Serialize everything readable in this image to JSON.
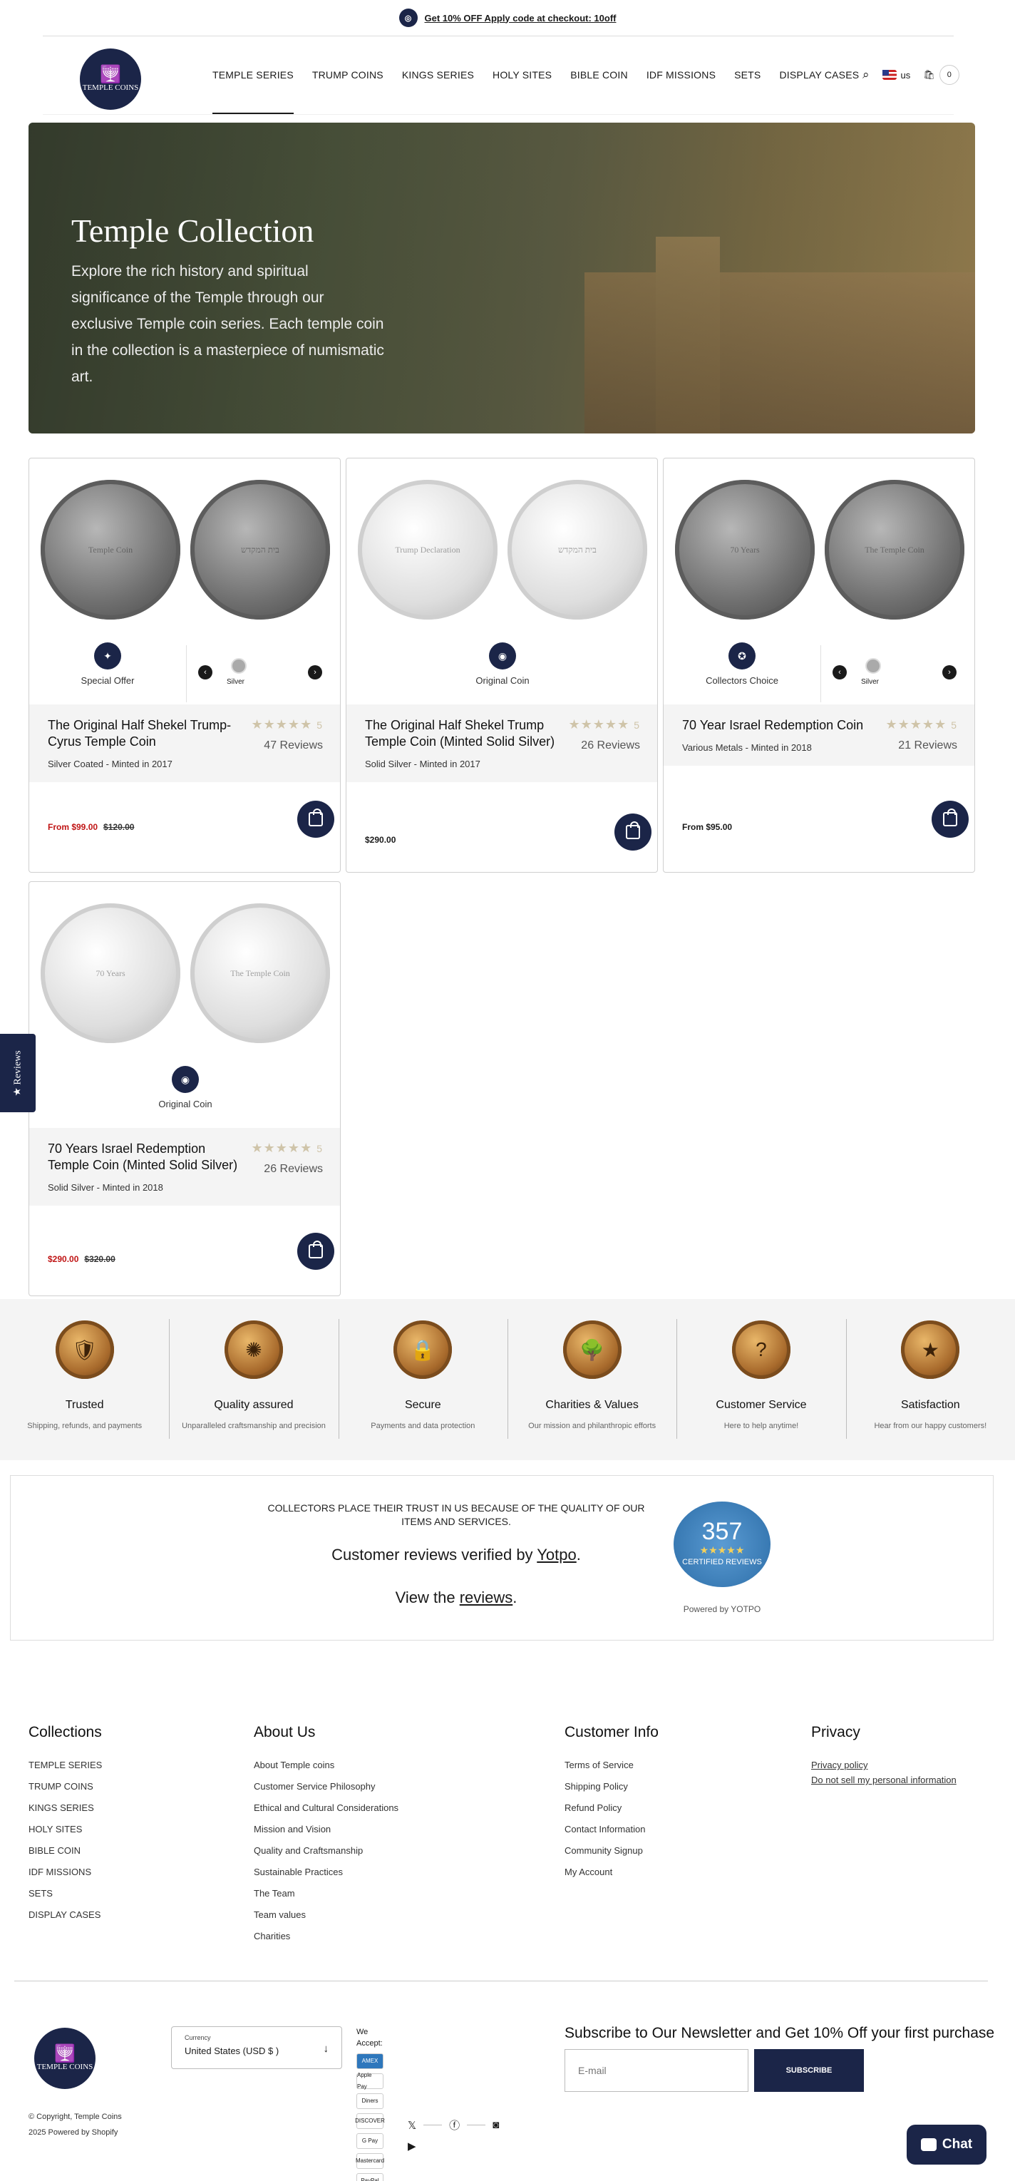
{
  "announcement": {
    "text": "Get 10% OFF Apply code at checkout: 10off",
    "icon": "coin-icon"
  },
  "brand": {
    "logo_text": "TEMPLE COINS"
  },
  "nav": [
    "TEMPLE SERIES",
    "TRUMP COINS",
    "KINGS SERIES",
    "HOLY SITES",
    "BIBLE COIN",
    "IDF MISSIONS",
    "SETS",
    "DISPLAY CASES"
  ],
  "header": {
    "locale": "us",
    "cart_count": "0"
  },
  "hero": {
    "title": "Temple Collection",
    "text": "Explore the rich history and spiritual significance of the Temple through our exclusive Temple coin series. Each temple coin in the collection is a masterpiece of numismatic art."
  },
  "products": [
    {
      "badge": "Special Offer",
      "swatch": "Silver",
      "title": "The Original Half Shekel Trump-Cyrus Temple Coin",
      "rating": "5",
      "reviews": "47 Reviews",
      "subtitle": "Silver Coated - Minted in 2017",
      "price": "From $99.00",
      "compare": "$120.00",
      "on_sale": true
    },
    {
      "badge": "Original Coin",
      "swatch": "",
      "title": "The Original Half Shekel Trump Temple Coin (Minted Solid Silver)",
      "rating": "5",
      "reviews": "26 Reviews",
      "subtitle": "Solid Silver - Minted in 2017",
      "price": "$290.00",
      "compare": "",
      "on_sale": false
    },
    {
      "badge": "Collectors Choice",
      "swatch": "Silver",
      "title": "70 Year Israel Redemption Coin",
      "rating": "5",
      "reviews": "21 Reviews",
      "subtitle": "Various Metals - Minted in 2018",
      "price": "From $95.00",
      "compare": "",
      "on_sale": false
    },
    {
      "badge": "Original Coin",
      "swatch": "",
      "title": "70 Years Israel Redemption Temple Coin (Minted Solid Silver)",
      "rating": "5",
      "reviews": "26 Reviews",
      "subtitle": "Solid Silver - Minted in 2018",
      "price": "$290.00",
      "compare": "$320.00",
      "on_sale": true
    }
  ],
  "features": [
    {
      "title": "Trusted",
      "text": "Shipping, refunds, and payments"
    },
    {
      "title": "Quality assured",
      "text": "Unparalleled craftsmanship and precision"
    },
    {
      "title": "Secure",
      "text": "Payments and data protection"
    },
    {
      "title": "Charities & Values",
      "text": "Our mission and philanthropic efforts"
    },
    {
      "title": "Customer Service",
      "text": "Here to help anytime!"
    },
    {
      "title": "Satisfaction",
      "text": "Hear from our happy customers!"
    }
  ],
  "yotpo": {
    "trust": "COLLECTORS PLACE THEIR TRUST IN US BECAUSE OF THE QUALITY OF OUR ITEMS AND SERVICES.",
    "verified_prefix": "Customer reviews verified by ",
    "verified_link": "Yotpo",
    "view_prefix": "View the ",
    "view_link": "reviews",
    "seal_count": "357",
    "seal_label": "CERTIFIED REVIEWS",
    "powered": "Powered by YOTPO"
  },
  "footer": {
    "collections": {
      "title": "Collections",
      "links": [
        "TEMPLE SERIES",
        "TRUMP COINS",
        "KINGS SERIES",
        "HOLY SITES",
        "BIBLE COIN",
        "IDF MISSIONS",
        "SETS",
        "DISPLAY CASES"
      ]
    },
    "about": {
      "title": "About Us",
      "links": [
        "About Temple coins",
        "Customer Service Philosophy",
        "Ethical and Cultural Considerations",
        "Mission and Vision",
        "Quality and Craftsmanship",
        "Sustainable Practices",
        "The Team",
        "Team values",
        "Charities"
      ]
    },
    "info": {
      "title": "Customer Info",
      "links": [
        "Terms of Service",
        "Shipping Policy",
        "Refund Policy",
        "Contact Information",
        "Community Signup",
        "My Account"
      ]
    },
    "privacy": {
      "title": "Privacy",
      "links": [
        "Privacy policy",
        "Do not sell my personal information"
      ]
    },
    "copyright_line1": "© Copyright, Temple Coins",
    "copyright_line2": "2025  Powered by Shopify",
    "currency_label": "Currency",
    "currency_value": "United States (USD $ )",
    "we_accept": "We Accept:",
    "payments": [
      "AMEX",
      "Apple Pay",
      "Diners",
      "DISCOVER",
      "G Pay",
      "Mastercard",
      "PayPal"
    ],
    "newsletter_title": "Subscribe to Our Newsletter and Get 10% Off your first purchase",
    "email_placeholder": "E-mail",
    "subscribe": "SUBSCRIBE"
  },
  "reviews_tab": "★ Reviews",
  "chat": "Chat"
}
